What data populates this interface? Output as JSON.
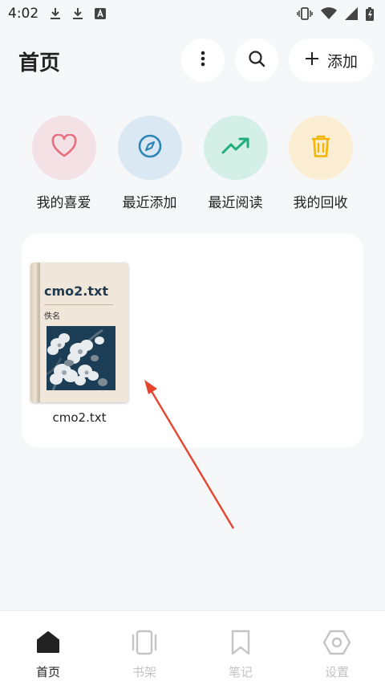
{
  "status_bar": {
    "time": "4:02",
    "icons": [
      "download-icon",
      "download-icon",
      "a-keyboard-icon",
      "vibrate-icon",
      "wifi-icon",
      "signal-icon",
      "battery-charging-icon"
    ]
  },
  "header": {
    "title": "首页",
    "more_icon": "more-vert-icon",
    "search_icon": "search-icon",
    "add_label": "添加"
  },
  "quick_actions": [
    {
      "label": "我的喜爱",
      "icon": "heart-icon",
      "bg": "#f3e1e5",
      "color": "#e96f7f"
    },
    {
      "label": "最近添加",
      "icon": "compass-icon",
      "bg": "#d9e8f2",
      "color": "#2d86b5"
    },
    {
      "label": "最近阅读",
      "icon": "trending-up-icon",
      "bg": "#d4efe6",
      "color": "#1fae7c"
    },
    {
      "label": "我的回收",
      "icon": "trash-icon",
      "bg": "#faedd1",
      "color": "#f5b400"
    }
  ],
  "books": [
    {
      "cover_title": "cmo2.txt",
      "cover_author": "佚名",
      "name": "cmo2.txt"
    }
  ],
  "bottom_nav": [
    {
      "label": "首页",
      "icon": "home-icon",
      "active": true
    },
    {
      "label": "书架",
      "icon": "bookshelf-icon",
      "active": false
    },
    {
      "label": "笔记",
      "icon": "bookmark-icon",
      "active": false
    },
    {
      "label": "设置",
      "icon": "settings-icon",
      "active": false
    }
  ],
  "colors": {
    "background": "#f6f7f9",
    "active_nav": "#222222",
    "inactive_nav": "#c4c4c4",
    "annotation_arrow": "#e5452f"
  }
}
